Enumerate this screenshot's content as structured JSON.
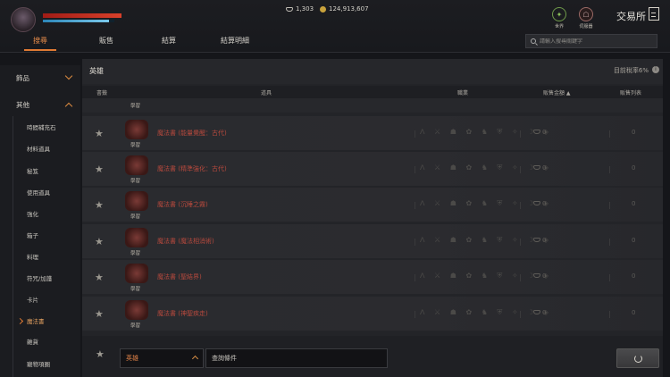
{
  "player": {
    "hp_fraction": 1.0,
    "mp_fraction": 0.92
  },
  "currencies": {
    "gems": "1,303",
    "gold": "124,913,607"
  },
  "top_right": {
    "world_label": "世界",
    "server_label": "伺服器",
    "exchange_title": "交易所"
  },
  "tabs": [
    {
      "label": "搜尋",
      "active": true
    },
    {
      "label": "販售"
    },
    {
      "label": "結算"
    },
    {
      "label": "結算明細"
    }
  ],
  "search": {
    "placeholder": "請輸入搜尋關鍵字"
  },
  "sidebar": {
    "categories": [
      {
        "label": "飾品"
      },
      {
        "label": "其他"
      }
    ],
    "subitems": [
      {
        "label": "時間補充石"
      },
      {
        "label": "材料道具"
      },
      {
        "label": "秘笈"
      },
      {
        "label": "使用道具"
      },
      {
        "label": "強化"
      },
      {
        "label": "箱子"
      },
      {
        "label": "料理"
      },
      {
        "label": "符咒/加護"
      },
      {
        "label": "卡片"
      },
      {
        "label": "魔法書",
        "active": true
      },
      {
        "label": "雜貨"
      },
      {
        "label": "寵物項圈"
      }
    ]
  },
  "main": {
    "title": "英雄",
    "tax_rate": "目前稅率6%",
    "columns": {
      "bookmark": "書籤",
      "item": "道具",
      "class": "職業",
      "price": "販售金額 ▲",
      "listing": "販售列表"
    }
  },
  "rows": [
    {
      "name": "魔法書 (能量覺醒：古代)",
      "learn": "學習",
      "price": "0",
      "count": "0"
    },
    {
      "name": "魔法書 (精準強化：古代)",
      "learn": "學習",
      "price": "0",
      "count": "0"
    },
    {
      "name": "魔法書 (沉睡之霧)",
      "learn": "學習",
      "price": "0",
      "count": "0"
    },
    {
      "name": "魔法書 (魔法相消術)",
      "learn": "學習",
      "price": "0",
      "count": "0"
    },
    {
      "name": "魔法書 (聖結界)",
      "learn": "學習",
      "price": "0",
      "count": "0"
    },
    {
      "name": "魔法書 (神聖疾走)",
      "learn": "學習",
      "price": "0",
      "count": "0"
    }
  ],
  "top_partial_row": {
    "learn": "學習"
  },
  "filter": {
    "class_selected": "英雄",
    "query_label": "查詢條件"
  },
  "class_icons_text": "ᐱ ⚔ ☗ ✿ ♞ ⛨ ✧ ☽ ◈"
}
